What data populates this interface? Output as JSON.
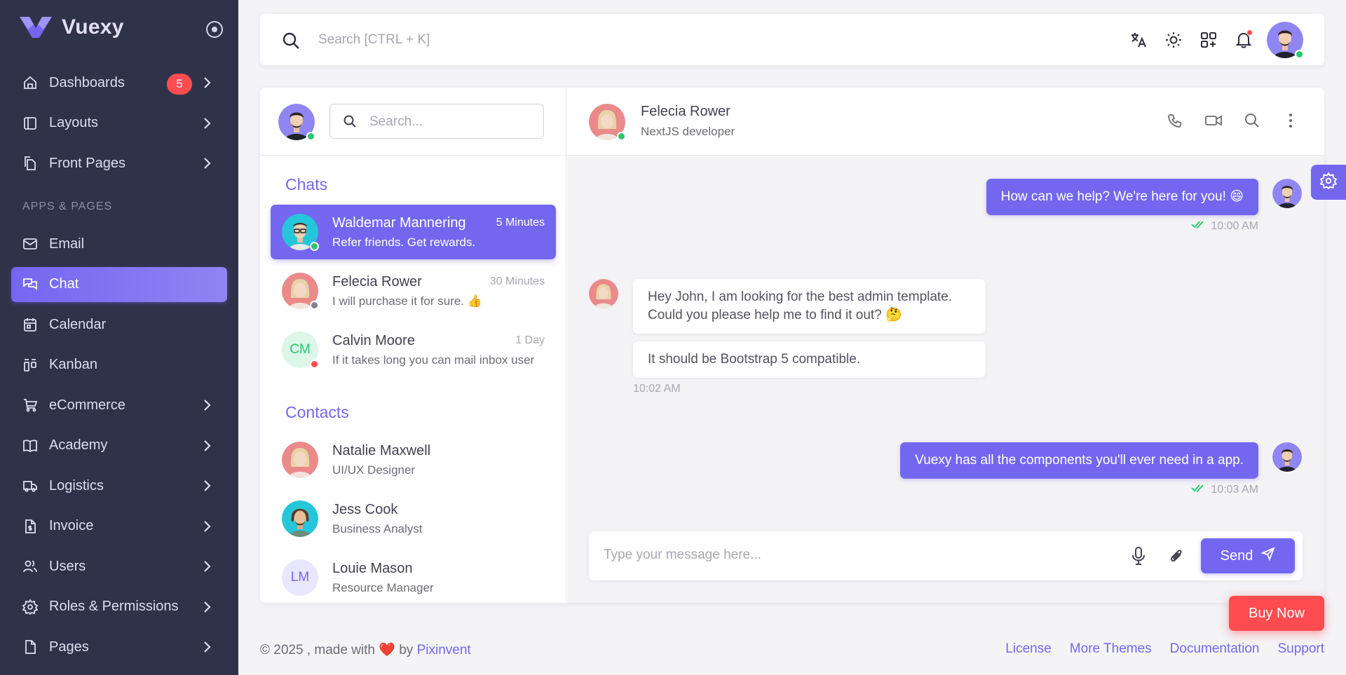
{
  "brand": {
    "name": "Vuexy",
    "logo_color": "#7367f0"
  },
  "sidebar": {
    "items": [
      {
        "label": "Dashboards",
        "icon": "home-icon",
        "badge": "5",
        "has_children": true
      },
      {
        "label": "Layouts",
        "icon": "layout-icon",
        "has_children": true
      },
      {
        "label": "Front Pages",
        "icon": "files-icon",
        "has_children": true
      }
    ],
    "section_title": "APPS & PAGES",
    "apps": [
      {
        "label": "Email",
        "icon": "mail-icon",
        "has_children": false
      },
      {
        "label": "Chat",
        "icon": "chat-icon",
        "has_children": false,
        "active": true
      },
      {
        "label": "Calendar",
        "icon": "calendar-icon",
        "has_children": false
      },
      {
        "label": "Kanban",
        "icon": "kanban-icon",
        "has_children": false
      },
      {
        "label": "eCommerce",
        "icon": "cart-icon",
        "has_children": true
      },
      {
        "label": "Academy",
        "icon": "book-icon",
        "has_children": true
      },
      {
        "label": "Logistics",
        "icon": "truck-icon",
        "has_children": true
      },
      {
        "label": "Invoice",
        "icon": "invoice-icon",
        "has_children": true
      },
      {
        "label": "Users",
        "icon": "users-icon",
        "has_children": true
      },
      {
        "label": "Roles & Permissions",
        "icon": "settings-icon",
        "has_children": true
      },
      {
        "label": "Pages",
        "icon": "page-icon",
        "has_children": true
      }
    ]
  },
  "navbar": {
    "search_placeholder": "Search [CTRL + K]",
    "icons": [
      "translate-icon",
      "sun-icon",
      "apps-add-icon",
      "bell-icon"
    ]
  },
  "chat_sidebar": {
    "search_placeholder": "Search...",
    "chats_heading": "Chats",
    "contacts_heading": "Contacts",
    "chats": [
      {
        "name": "Waldemar Mannering",
        "message": "Refer friends. Get rewards.",
        "time": "5 Minutes",
        "status": "online",
        "active": true
      },
      {
        "name": "Felecia Rower",
        "message": "I will purchase it for sure. 👍",
        "time": "30 Minutes",
        "status": "away"
      },
      {
        "name": "Calvin Moore",
        "initials": "CM",
        "message": "If it takes long you can mail inbox user",
        "time": "1 Day",
        "status": "busy"
      }
    ],
    "contacts": [
      {
        "name": "Natalie Maxwell",
        "role": "UI/UX Designer"
      },
      {
        "name": "Jess Cook",
        "role": "Business Analyst"
      },
      {
        "name": "Louie Mason",
        "initials": "LM",
        "role": "Resource Manager"
      }
    ]
  },
  "conversation": {
    "contact_name": "Felecia Rower",
    "contact_role": "NextJS developer",
    "messages": [
      {
        "from": "me",
        "text": "How can we help? We're here for you! 😄",
        "time": "10:00 AM"
      },
      {
        "from": "them",
        "text_line1": "Hey John, I am looking for the best admin template.",
        "text_line2": "Could you please help me to find it out? 🤔"
      },
      {
        "from": "them",
        "text": "It should be Bootstrap 5 compatible.",
        "time": "10:02 AM"
      },
      {
        "from": "me",
        "text": "Vuexy has all the components you'll ever need in a app.",
        "time": "10:03 AM"
      }
    ],
    "composer_placeholder": "Type your message here...",
    "send_label": "Send"
  },
  "buy_now_label": "Buy Now",
  "footer": {
    "copyright_prefix": "© 2025 , made with",
    "heart": "❤️",
    "by": "by",
    "company": "Pixinvent",
    "links": [
      "License",
      "More Themes",
      "Documentation",
      "Support"
    ]
  },
  "colors": {
    "primary": "#7367f0",
    "sidebar_bg": "#2f3349",
    "danger": "#ff4c51",
    "success": "#28c76f"
  }
}
